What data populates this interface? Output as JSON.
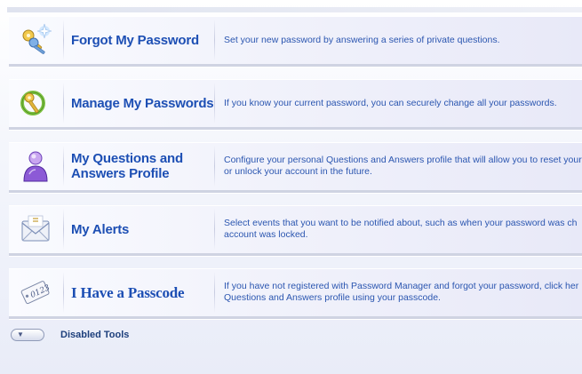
{
  "tools": [
    {
      "icon": "keys-sparkle-icon",
      "title": "Forgot My Password",
      "description_lines": [
        "Set your new password by answering a series of private questions."
      ]
    },
    {
      "icon": "green-key-icon",
      "title": "Manage My Passwords",
      "description_lines": [
        "If you know your current password, you can securely change all your passwords."
      ]
    },
    {
      "icon": "user-profile-icon",
      "title_lines": [
        "My Questions and",
        "Answers Profile"
      ],
      "description_lines": [
        "Configure your personal Questions and Answers profile that will allow you to reset your",
        "or unlock your account in the future."
      ]
    },
    {
      "icon": "envelope-icon",
      "title": "My Alerts",
      "description_lines": [
        "Select events that you want to be notified about, such as when your password was ch",
        "account was locked."
      ]
    },
    {
      "icon": "passcode-tag-icon",
      "title": "I Have a Passcode",
      "description_lines": [
        "If you have not registered with Password Manager and forgot your password, click her",
        "Questions and Answers profile using your passcode."
      ]
    }
  ],
  "disabled_section": {
    "label": "Disabled Tools",
    "expander_icon": "chevron-down-icon"
  },
  "colors": {
    "title": "#1d4fb4",
    "description": "#2b56b0",
    "row_border": "#cfd3e2"
  }
}
